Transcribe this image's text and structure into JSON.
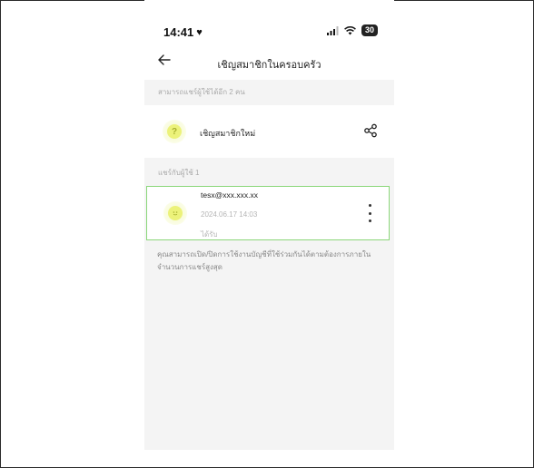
{
  "status_bar": {
    "time": "14:41",
    "battery": "30"
  },
  "header": {
    "title": "เชิญสมาชิกในครอบครัว"
  },
  "invite_section": {
    "label": "สามารถแชร์ผู้ใช้ได้อีก 2 คน",
    "invite_label": "เชิญสมาชิกใหม่",
    "avatar_glyph": "?"
  },
  "shared_section": {
    "label": "แชร์กับผู้ใช้ 1",
    "members": [
      {
        "email": "tesx@xxx.xxx.xx",
        "date": "2024.06.17 14:03",
        "status": "ได้รับ"
      }
    ]
  },
  "note": "คุณสามารถเปิด/ปิดการใช้งานบัญชีที่ใช้ร่วมกันได้ตามต้องการภายในจำนวนการแชร์สูงสุด",
  "colors": {
    "accent_border": "#8bd77a",
    "avatar_yellow": "#ecf27a"
  },
  "icons": {
    "back": "arrow-left-icon",
    "share": "share-icon",
    "more": "kebab-menu-icon"
  }
}
